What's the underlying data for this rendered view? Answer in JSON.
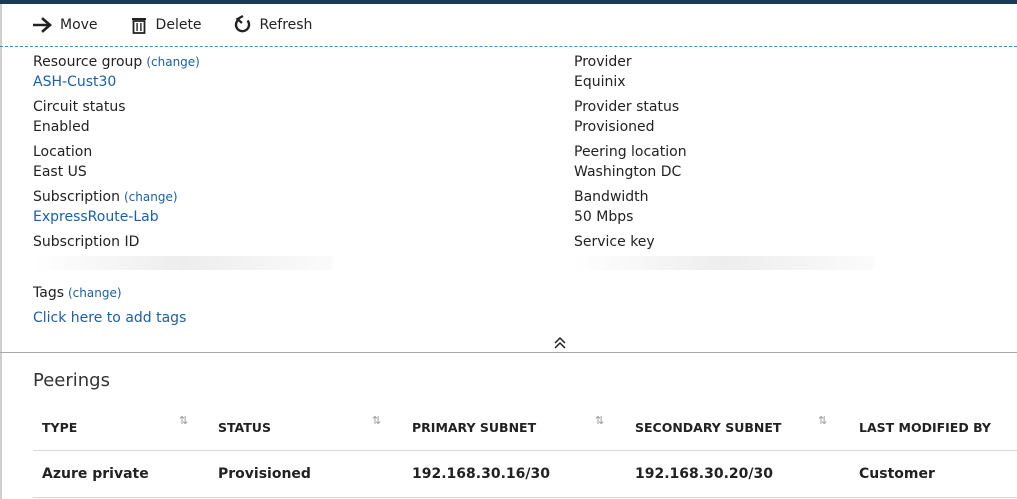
{
  "toolbar": {
    "move_label": "Move",
    "delete_label": "Delete",
    "refresh_label": "Refresh"
  },
  "essentials": {
    "left": [
      {
        "label": "Resource group",
        "change": "(change)",
        "value": "ASH-Cust30",
        "value_is_link": true
      },
      {
        "label": "Circuit status",
        "value": "Enabled"
      },
      {
        "label": "Location",
        "value": "East US"
      },
      {
        "label": "Subscription",
        "change": "(change)",
        "value": "ExpressRoute-Lab",
        "value_is_link": true
      },
      {
        "label": "Subscription ID",
        "value": ""
      }
    ],
    "right": [
      {
        "label": "Provider",
        "value": "Equinix"
      },
      {
        "label": "Provider status",
        "value": "Provisioned"
      },
      {
        "label": "Peering location",
        "value": "Washington DC"
      },
      {
        "label": "Bandwidth",
        "value": "50 Mbps"
      },
      {
        "label": "Service key",
        "value": ""
      }
    ]
  },
  "tags": {
    "label": "Tags",
    "change": "(change)",
    "add_link": "Click here to add tags"
  },
  "peerings": {
    "title": "Peerings",
    "columns": [
      "TYPE",
      "STATUS",
      "PRIMARY SUBNET",
      "SECONDARY SUBNET",
      "LAST MODIFIED BY"
    ],
    "rows": [
      [
        "Azure private",
        "Provisioned",
        "192.168.30.16/30",
        "192.168.30.20/30",
        "Customer"
      ]
    ]
  },
  "colors": {
    "link": "#1a5fa8",
    "header_bar": "#1c3a57"
  },
  "icons": {
    "move": "arrow-right-icon",
    "delete": "trash-icon",
    "refresh": "refresh-icon",
    "collapse": "double-chevron-up-icon",
    "sort": "sort-arrows-icon"
  }
}
